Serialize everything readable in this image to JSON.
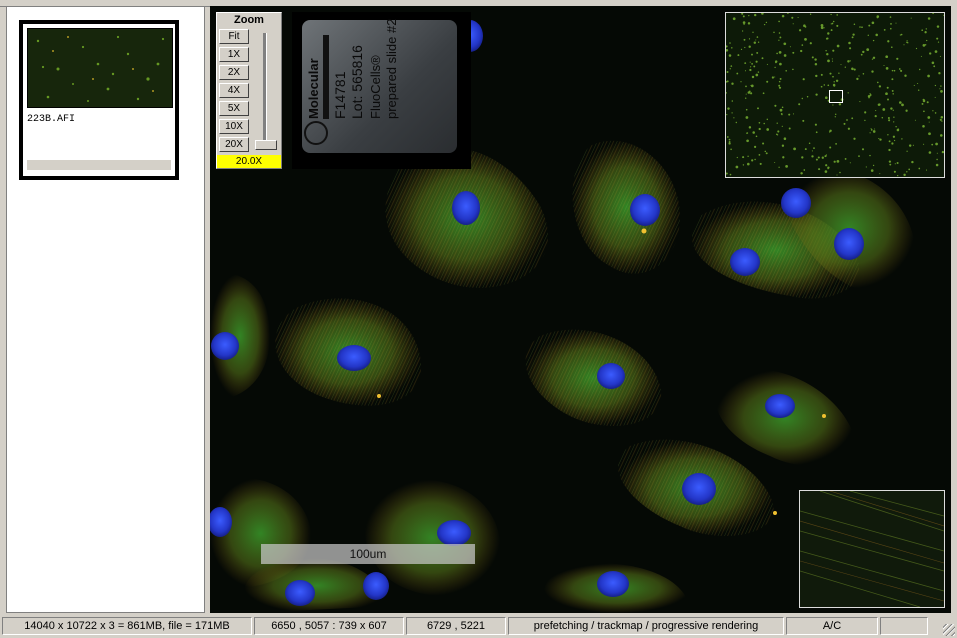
{
  "thumbnail": {
    "filename": "223B.AFI"
  },
  "zoom": {
    "title": "Zoom",
    "buttons": [
      "Fit",
      "1X",
      "2X",
      "4X",
      "5X",
      "10X",
      "20X"
    ],
    "current": "20.0X"
  },
  "slide_label": {
    "brand": "Molecular",
    "catalog": "F14781",
    "lot": "Lot: 565816",
    "product": "FluoCells®",
    "description": "prepared slide #2"
  },
  "scalebar": {
    "label": "100um"
  },
  "status": {
    "dimensions": "14040 x 10722 x 3 = 861MB, file = 171MB",
    "viewport": "6650 , 5057 : 739 x 607",
    "cursor": "6729 , 5221",
    "mode": "prefetching / trackmap / progressive rendering",
    "flag": "A/C"
  },
  "colors": {
    "highlight": "#ffff00",
    "nucleus": "#2a44d8",
    "actin": "#2fae2a",
    "tubulin": "#c98a1a"
  }
}
